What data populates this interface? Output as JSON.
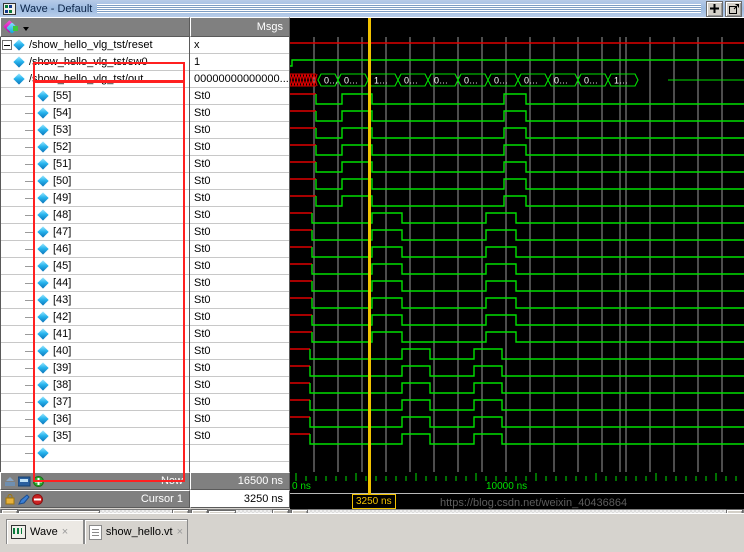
{
  "window": {
    "title": "Wave - Default",
    "title_icon": "wave-window-icon",
    "buttons": [
      {
        "name": "dock-button",
        "glyph": "+"
      },
      {
        "name": "undock-button",
        "glyph": "undock"
      }
    ]
  },
  "columns": {
    "names_header": "",
    "names_header_icon": "signal-gem-icon",
    "msgs_header": "Msgs"
  },
  "signals": [
    {
      "name": "/show_hello_vlg_tst/reset",
      "value": "x",
      "level": 1,
      "kind": "scalar",
      "highlight": false
    },
    {
      "name": "/show_hello_vlg_tst/sw0",
      "value": "1",
      "level": 1,
      "kind": "scalar",
      "highlight": true
    },
    {
      "name": "/show_hello_vlg_tst/out",
      "value": "00000000000000...",
      "level": 1,
      "kind": "bus",
      "expanded": true,
      "highlight": false
    },
    {
      "name": "[55]",
      "value": "St0",
      "level": 2,
      "kind": "bit"
    },
    {
      "name": "[54]",
      "value": "St0",
      "level": 2,
      "kind": "bit"
    },
    {
      "name": "[53]",
      "value": "St0",
      "level": 2,
      "kind": "bit"
    },
    {
      "name": "[52]",
      "value": "St0",
      "level": 2,
      "kind": "bit"
    },
    {
      "name": "[51]",
      "value": "St0",
      "level": 2,
      "kind": "bit"
    },
    {
      "name": "[50]",
      "value": "St0",
      "level": 2,
      "kind": "bit"
    },
    {
      "name": "[49]",
      "value": "St0",
      "level": 2,
      "kind": "bit"
    },
    {
      "name": "[48]",
      "value": "St0",
      "level": 2,
      "kind": "bit"
    },
    {
      "name": "[47]",
      "value": "St0",
      "level": 2,
      "kind": "bit"
    },
    {
      "name": "[46]",
      "value": "St0",
      "level": 2,
      "kind": "bit"
    },
    {
      "name": "[45]",
      "value": "St0",
      "level": 2,
      "kind": "bit"
    },
    {
      "name": "[44]",
      "value": "St0",
      "level": 2,
      "kind": "bit"
    },
    {
      "name": "[43]",
      "value": "St0",
      "level": 2,
      "kind": "bit"
    },
    {
      "name": "[42]",
      "value": "St0",
      "level": 2,
      "kind": "bit"
    },
    {
      "name": "[41]",
      "value": "St0",
      "level": 2,
      "kind": "bit"
    },
    {
      "name": "[40]",
      "value": "St0",
      "level": 2,
      "kind": "bit"
    },
    {
      "name": "[39]",
      "value": "St0",
      "level": 2,
      "kind": "bit"
    },
    {
      "name": "[38]",
      "value": "St0",
      "level": 2,
      "kind": "bit"
    },
    {
      "name": "[37]",
      "value": "St0",
      "level": 2,
      "kind": "bit"
    },
    {
      "name": "[36]",
      "value": "St0",
      "level": 2,
      "kind": "bit"
    },
    {
      "name": "[35]",
      "value": "St0",
      "level": 2,
      "kind": "bit"
    }
  ],
  "bus_segments": [
    "0…",
    "0…",
    "1…",
    "0…",
    "0…",
    "0…",
    "0…",
    "0…",
    "0…",
    "0…",
    "1…"
  ],
  "footer": {
    "now_label": "Now",
    "now_value": "16500 ns",
    "cursor_label": "Cursor 1",
    "cursor_value": "3250 ns",
    "left_icons_top": [
      "now-marker-icon",
      "insert-icon",
      "add-cursor-icon"
    ],
    "left_icons_bottom": [
      "lock-icon",
      "edit-cursor-icon",
      "delete-cursor-icon"
    ]
  },
  "timeline": {
    "left_label": "0 ns",
    "mid_label": "10000 ns",
    "cursor_badge": "3250 ns"
  },
  "tabs": [
    {
      "label": "Wave",
      "icon": "wave-tab-icon",
      "active": true,
      "close": "×"
    },
    {
      "label": "show_hello.vt",
      "icon": "document-tab-icon",
      "active": false,
      "close": "×"
    }
  ],
  "watermark": "https://blog.csdn.net/weixin_40436864",
  "colors": {
    "accent_cursor": "#f2c200",
    "signal_green": "#00e000",
    "signal_red": "#e00000",
    "wave_bg": "#000000",
    "panel_bg": "#d6d3ce",
    "header_gray": "#808080",
    "annotation_red": "#ff2020"
  }
}
